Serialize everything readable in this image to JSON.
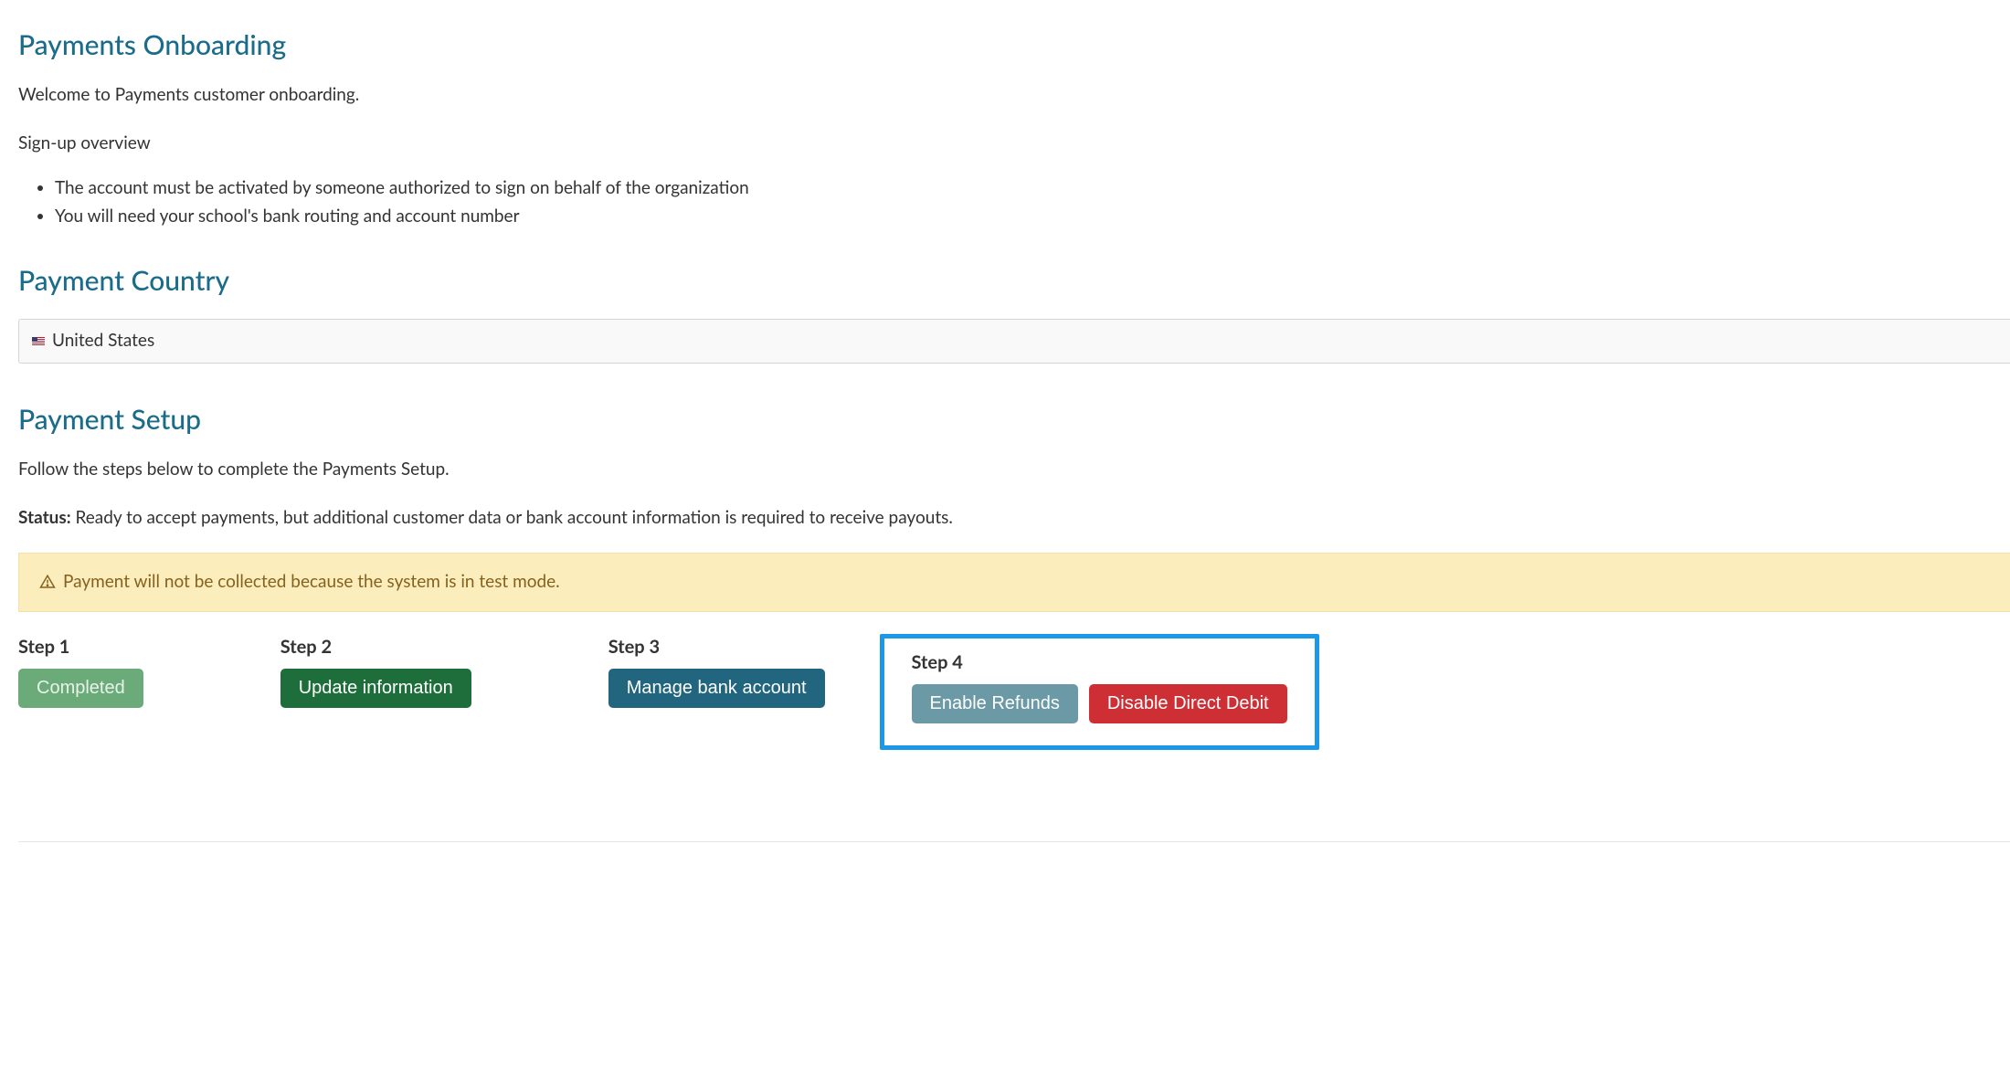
{
  "onboarding": {
    "title": "Payments Onboarding",
    "welcome": "Welcome to Payments customer onboarding.",
    "overviewLabel": "Sign-up overview",
    "bullets": [
      "The account must be activated by someone authorized to sign on behalf of the organization",
      "You will need your school's bank routing and account number"
    ]
  },
  "country": {
    "title": "Payment Country",
    "selected": "United States"
  },
  "setup": {
    "title": "Payment Setup",
    "instructions": "Follow the steps below to complete the Payments Setup.",
    "statusLabel": "Status:",
    "statusText": " Ready to accept payments, but additional customer data or bank account information is required to receive payouts.",
    "warning": "Payment will not be collected because the system is in test mode."
  },
  "steps": {
    "step1": {
      "title": "Step 1",
      "button": "Completed"
    },
    "step2": {
      "title": "Step 2",
      "button": "Update information"
    },
    "step3": {
      "title": "Step 3",
      "button": "Manage bank account"
    },
    "step4": {
      "title": "Step 4",
      "refunds": "Enable Refunds",
      "disable": "Disable Direct Debit"
    }
  }
}
